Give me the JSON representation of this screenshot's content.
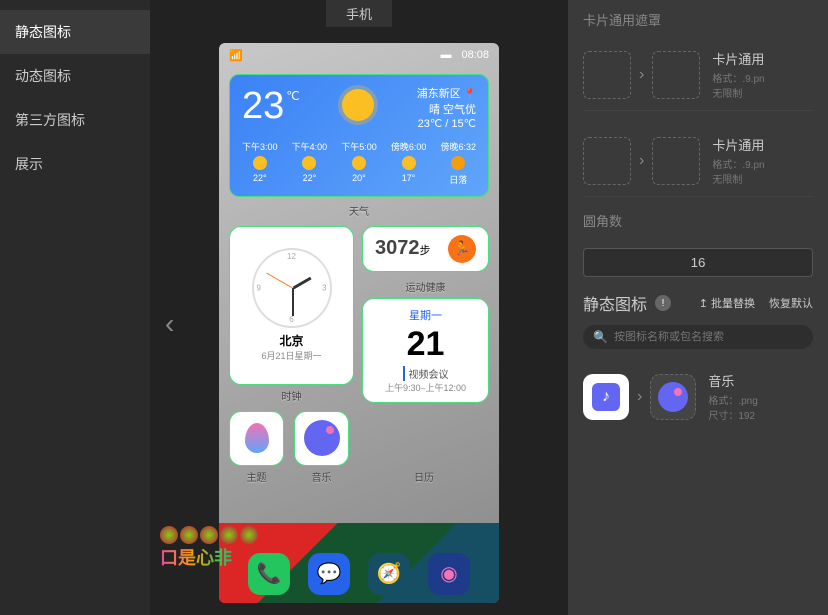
{
  "left_panel": {
    "items": [
      "静态图标",
      "动态图标",
      "第三方图标",
      "展示"
    ]
  },
  "center": {
    "tab": "手机",
    "status": {
      "signal": "▮▮▮▮",
      "battery": "▬",
      "time": "08:08"
    },
    "weather": {
      "temp": "23",
      "deg": "℃",
      "location": "浦东新区",
      "condition": "晴 空气优",
      "hi_lo": "23℃ / 15℃",
      "forecast": [
        {
          "time": "下午3:00",
          "temp": "22°"
        },
        {
          "time": "下午4:00",
          "temp": "22°"
        },
        {
          "time": "下午5:00",
          "temp": "20°"
        },
        {
          "time": "傍晚6:00",
          "temp": "17°"
        },
        {
          "time": "傍晚6:32",
          "temp": "日落"
        }
      ],
      "label": "天气"
    },
    "clock": {
      "city": "北京",
      "date": "6月21日星期一",
      "label": "时钟"
    },
    "steps": {
      "count": "3072",
      "unit": "步",
      "label": "运动健康"
    },
    "calendar": {
      "dow": "星期一",
      "day": "21",
      "event": "视频会议",
      "time": "上午9:30–上午12:00",
      "label": "日历"
    },
    "icons": {
      "theme": "主题",
      "music": "音乐"
    },
    "watermark": "口是心非"
  },
  "right": {
    "masks_title": "卡片通用遮罩",
    "mask_items": [
      {
        "title": "卡片通用",
        "fmt": "格式：.9.pn",
        "limit": "无限制"
      },
      {
        "title": "卡片通用",
        "fmt": "格式：.9.pn",
        "limit": "无限制"
      }
    ],
    "radius_label": "圆角数",
    "radius_value": "16",
    "icons_header": "静态图标",
    "batch": "批量替换",
    "restore": "恢复默认",
    "upload_icon_prefix": "↥",
    "search_placeholder": "按图标名称或包名搜索",
    "app": {
      "name": "音乐",
      "fmt": "格式：.png",
      "size": "尺寸：192"
    }
  }
}
